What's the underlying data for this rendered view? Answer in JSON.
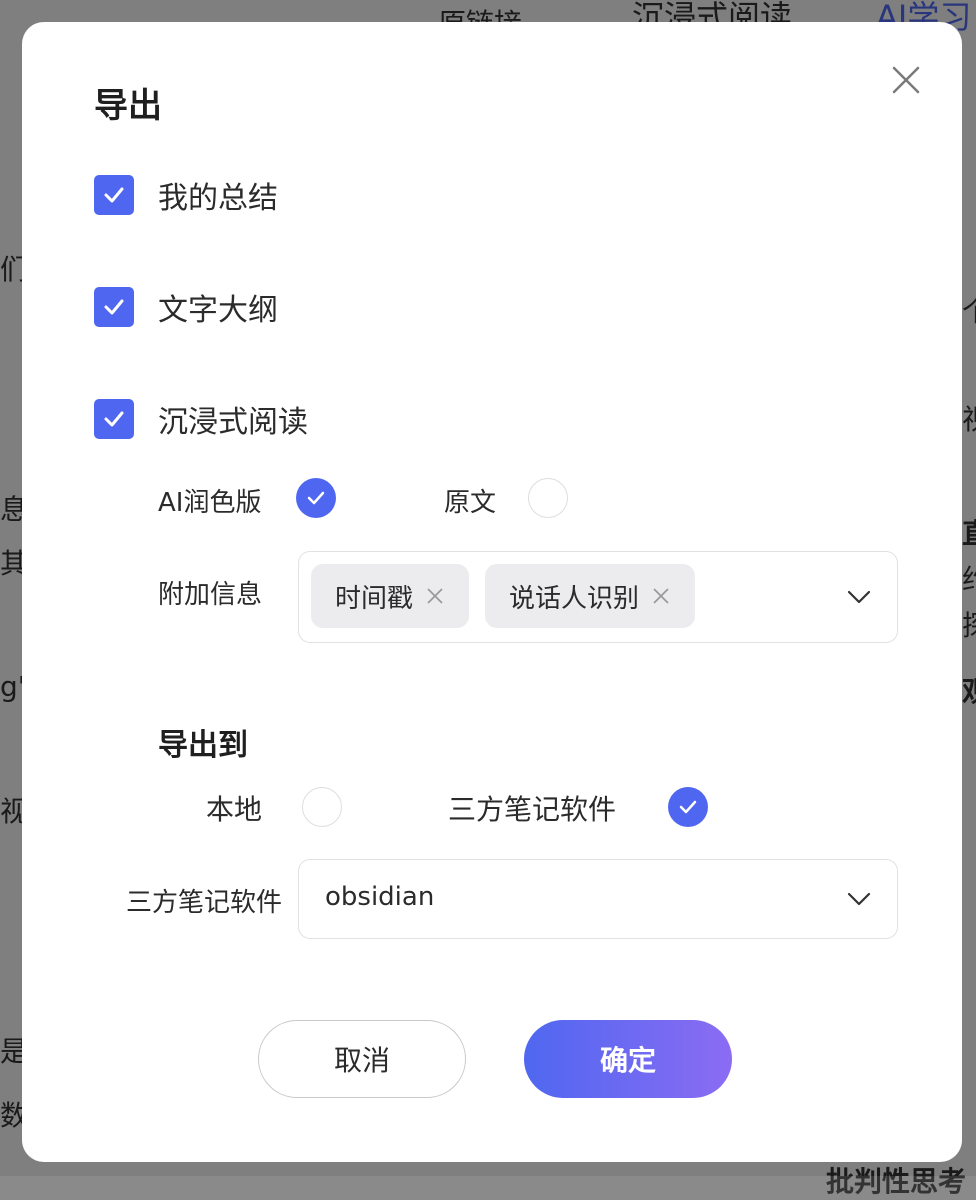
{
  "background": {
    "fragments": [
      "原链接",
      "沉浸式阅读",
      "AI学习",
      "们\"",
      "个",
      "视",
      "直",
      "息",
      "其",
      "约",
      "探",
      "g'",
      "观",
      "视频",
      "是中",
      "数的",
      "批判性思考"
    ]
  },
  "dialog": {
    "title": "导出",
    "close_icon": "close-icon",
    "options": [
      {
        "label": "我的总结",
        "checked": true
      },
      {
        "label": "文字大纲",
        "checked": true
      },
      {
        "label": "沉浸式阅读",
        "checked": true
      }
    ],
    "version": {
      "ai_label": "AI润色版",
      "ai_selected": true,
      "original_label": "原文",
      "original_selected": false
    },
    "extra_info": {
      "label": "附加信息",
      "tags": [
        "时间戳",
        "说话人识别"
      ]
    },
    "export_to": {
      "heading": "导出到",
      "local_label": "本地",
      "local_selected": false,
      "third_party_label": "三方笔记软件",
      "third_party_selected": true
    },
    "software": {
      "label": "三方笔记软件",
      "value": "obsidian"
    },
    "buttons": {
      "cancel": "取消",
      "confirm": "确定"
    }
  },
  "colors": {
    "accent": "#4f67f0",
    "gradient_end": "#8b6cf3"
  }
}
